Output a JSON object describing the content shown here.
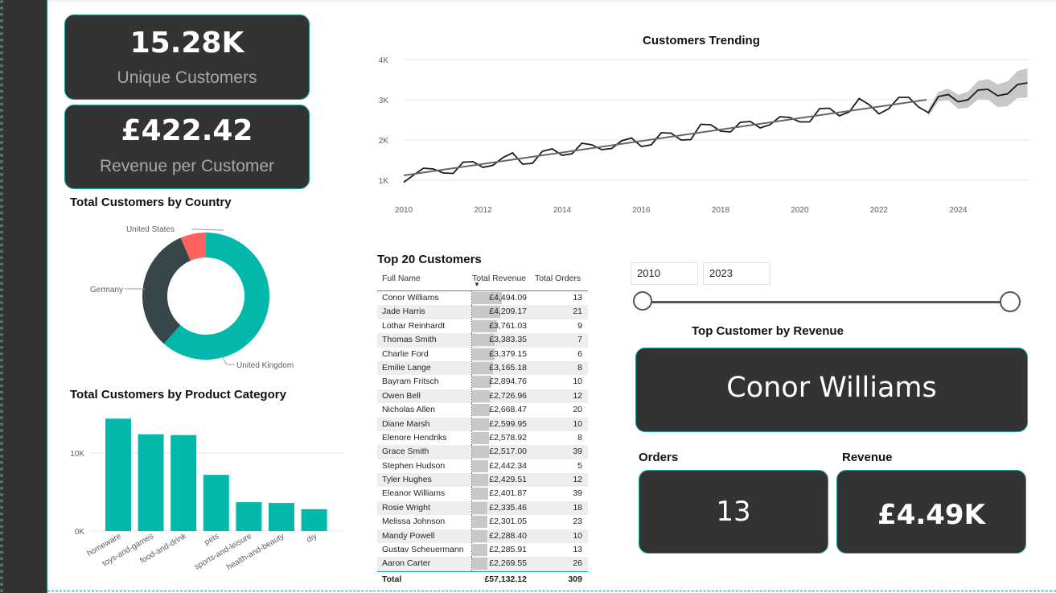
{
  "kpis": {
    "unique_customers": {
      "value": "15.28K",
      "label": "Unique Customers"
    },
    "revenue_per_customer": {
      "value": "£422.42",
      "label": "Revenue per Customer"
    }
  },
  "trend": {
    "title": "Customers Trending",
    "y_ticks": [
      "4K",
      "3K",
      "2K",
      "1K"
    ],
    "x_ticks": [
      "2010",
      "2012",
      "2014",
      "2016",
      "2018",
      "2020",
      "2022",
      "2024"
    ]
  },
  "country": {
    "title": "Total Customers by Country",
    "labels": {
      "us": "United States",
      "de": "Germany",
      "uk": "United Kingdom"
    }
  },
  "category": {
    "title": "Total Customers by Product Category",
    "y_ticks": [
      "10K",
      "0K"
    ]
  },
  "top20": {
    "title": "Top 20 Customers",
    "columns": [
      "Full Name",
      "Total Revenue",
      "Total Orders"
    ],
    "rows": [
      [
        "Conor Williams",
        "£4,494.09",
        "13"
      ],
      [
        "Jade Harris",
        "£4,209.17",
        "21"
      ],
      [
        "Lothar Reinhardt",
        "£3,761.03",
        "9"
      ],
      [
        "Thomas Smith",
        "£3,383.35",
        "7"
      ],
      [
        "Charlie Ford",
        "£3,379.15",
        "6"
      ],
      [
        "Emilie Lange",
        "£3,165.18",
        "8"
      ],
      [
        "Bayram Fritsch",
        "£2,894.76",
        "10"
      ],
      [
        "Owen Bell",
        "£2,726.96",
        "12"
      ],
      [
        "Nicholas Allen",
        "£2,668.47",
        "20"
      ],
      [
        "Diane Marsh",
        "£2,599.95",
        "10"
      ],
      [
        "Elenore Hendriks",
        "£2,578.92",
        "8"
      ],
      [
        "Grace Smith",
        "£2,517.00",
        "39"
      ],
      [
        "Stephen Hudson",
        "£2,442.34",
        "5"
      ],
      [
        "Tyler Hughes",
        "£2,429.51",
        "12"
      ],
      [
        "Eleanor Williams",
        "£2,401.87",
        "39"
      ],
      [
        "Rosie Wright",
        "£2,335.46",
        "18"
      ],
      [
        "Melissa Johnson",
        "£2,301.05",
        "23"
      ],
      [
        "Mandy Powell",
        "£2,288.40",
        "10"
      ],
      [
        "Gustav Scheuermann",
        "£2,285.91",
        "13"
      ],
      [
        "Aaron Carter",
        "£2,269.55",
        "26"
      ]
    ],
    "total": {
      "label": "Total",
      "revenue": "£57,132.12",
      "orders": "309"
    }
  },
  "slicer": {
    "from": "2010",
    "to": "2023"
  },
  "top_customer": {
    "title": "Top Customer by Revenue",
    "name": "Conor Williams",
    "orders_label": "Orders",
    "orders_value": "13",
    "revenue_label": "Revenue",
    "revenue_value": "£4.49K"
  },
  "colors": {
    "teal": "#01b8aa",
    "dark": "#374649",
    "red": "#fd625e",
    "card": "#333333"
  },
  "chart_data": [
    {
      "type": "line",
      "title": "Customers Trending",
      "xlabel": "",
      "ylabel": "",
      "x_range": [
        2010,
        2025.8
      ],
      "ylim": [
        700,
        4000
      ],
      "grid": true,
      "series": [
        {
          "values": [
            [
              2010.0,
              950
            ],
            [
              2010.25,
              1130
            ],
            [
              2010.5,
              1300
            ],
            [
              2010.75,
              1280
            ],
            [
              2011.0,
              1180
            ],
            [
              2011.25,
              1170
            ],
            [
              2011.5,
              1450
            ],
            [
              2011.75,
              1460
            ],
            [
              2012.0,
              1320
            ],
            [
              2012.25,
              1370
            ],
            [
              2012.5,
              1560
            ],
            [
              2012.75,
              1680
            ],
            [
              2013.0,
              1400
            ],
            [
              2013.25,
              1420
            ],
            [
              2013.5,
              1720
            ],
            [
              2013.75,
              1780
            ],
            [
              2014.0,
              1620
            ],
            [
              2014.25,
              1660
            ],
            [
              2014.5,
              1920
            ],
            [
              2014.75,
              1880
            ],
            [
              2015.0,
              1760
            ],
            [
              2015.25,
              1790
            ],
            [
              2015.5,
              1980
            ],
            [
              2015.75,
              2050
            ],
            [
              2016.0,
              1840
            ],
            [
              2016.25,
              1880
            ],
            [
              2016.5,
              2180
            ],
            [
              2016.75,
              2170
            ],
            [
              2017.0,
              2000
            ],
            [
              2017.25,
              2010
            ],
            [
              2017.5,
              2390
            ],
            [
              2017.75,
              2380
            ],
            [
              2018.0,
              2220
            ],
            [
              2018.25,
              2200
            ],
            [
              2018.5,
              2440
            ],
            [
              2018.75,
              2460
            ],
            [
              2019.0,
              2300
            ],
            [
              2019.25,
              2380
            ],
            [
              2019.5,
              2580
            ],
            [
              2019.75,
              2560
            ],
            [
              2020.0,
              2450
            ],
            [
              2020.25,
              2450
            ],
            [
              2020.5,
              2780
            ],
            [
              2020.75,
              2790
            ],
            [
              2021.0,
              2600
            ],
            [
              2021.25,
              2700
            ],
            [
              2021.5,
              3030
            ],
            [
              2021.75,
              2880
            ],
            [
              2022.0,
              2650
            ],
            [
              2022.25,
              2780
            ],
            [
              2022.5,
              3060
            ],
            [
              2022.75,
              3060
            ],
            [
              2023.0,
              2820
            ],
            [
              2023.25,
              2680
            ],
            [
              2023.5,
              3080
            ],
            [
              2023.75,
              3130
            ],
            [
              2024.0,
              2950
            ],
            [
              2024.25,
              3000
            ],
            [
              2024.5,
              3240
            ],
            [
              2024.75,
              3260
            ],
            [
              2025.0,
              3100
            ],
            [
              2025.25,
              3150
            ],
            [
              2025.5,
              3380
            ],
            [
              2025.75,
              3420
            ]
          ]
        },
        {
          "values": [
            [
              2010.0,
              1120
            ],
            [
              2023.2,
              3000
            ]
          ]
        }
      ],
      "forecast_band_from": 2023.5
    },
    {
      "type": "pie",
      "title": "Total Customers by Country",
      "categories": [
        "United Kingdom",
        "Germany",
        "United States"
      ],
      "values": [
        61.5,
        32,
        6.5
      ]
    },
    {
      "type": "bar",
      "title": "Total Customers by Product Category",
      "categories": [
        "homeware",
        "toys-and-games",
        "food-and-drink",
        "pets",
        "sports-and-leisure",
        "health-and-beauty",
        "diy"
      ],
      "values": [
        14400,
        12400,
        12300,
        7200,
        3700,
        3600,
        2800
      ],
      "ylim": [
        0,
        15000
      ]
    }
  ]
}
